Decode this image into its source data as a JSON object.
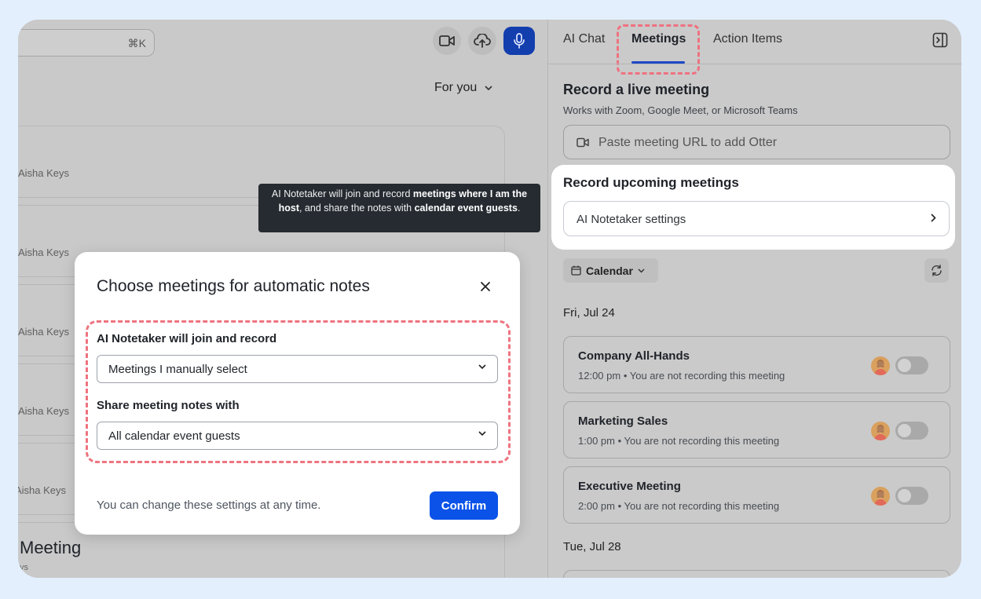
{
  "left": {
    "search_shortcut": "⌘K",
    "feed_filter": "For you",
    "feed_authors": [
      "Aisha Keys",
      "Aisha Keys",
      "Aisha Keys",
      "Aisha Keys",
      "Aisha Keys"
    ],
    "bottom_title": "Meeting",
    "bottom_sub": "ys"
  },
  "tooltip": {
    "p1": "AI Notetaker will join and record ",
    "b1": "meetings where I am the host",
    "p2": ", and share the notes with ",
    "b2": "calendar event guests",
    "p3": "."
  },
  "modal": {
    "title": "Choose meetings for automatic notes",
    "join_label": "AI Notetaker will join and record",
    "join_value": "Meetings I manually select",
    "share_label": "Share meeting notes with",
    "share_value": "All calendar event guests",
    "footer": "You can change these settings at any time.",
    "confirm": "Confirm"
  },
  "tabs": [
    {
      "label": "AI Chat"
    },
    {
      "label": "Meetings"
    },
    {
      "label": "Action Items"
    }
  ],
  "record_live": {
    "title": "Record a live meeting",
    "subtitle": "Works with Zoom, Google Meet, or Microsoft Teams",
    "placeholder": "Paste meeting URL to add Otter"
  },
  "record_upcoming": {
    "title": "Record upcoming meetings",
    "settings_label": "AI Notetaker settings"
  },
  "calendar_label": "Calendar",
  "days": [
    "Fri, Jul 24",
    "Tue, Jul 28"
  ],
  "meetings": [
    {
      "title": "Company All-Hands",
      "subtitle": "12:00 pm • You are not recording this meeting",
      "recording": false
    },
    {
      "title": "Marketing Sales",
      "subtitle": "1:00 pm • You are not recording this meeting",
      "recording": false
    },
    {
      "title": "Executive Meeting",
      "subtitle": "2:00 pm • You are not recording this meeting",
      "recording": false
    }
  ]
}
